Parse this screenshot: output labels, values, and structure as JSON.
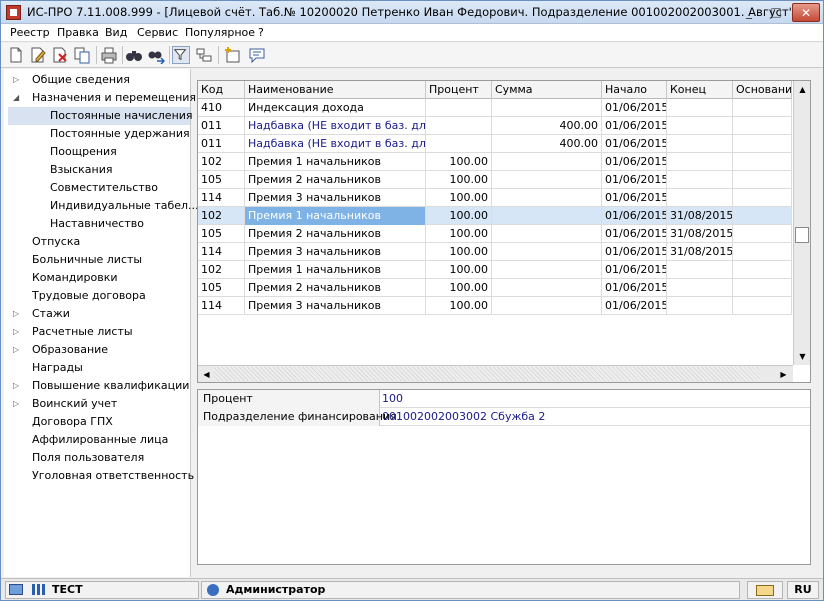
{
  "window": {
    "title": "ИС-ПРО 7.11.008.999 - [Лицевой счёт. Таб.№ 10200020 Петренко Иван Федорович. Подразделение 001002002003001. Август'15]",
    "min_label": "_",
    "max_label": "□",
    "close_label": "✕"
  },
  "menu": {
    "items": [
      "Реестр",
      "Правка",
      "Вид",
      "Сервис",
      "Популярное",
      "?"
    ]
  },
  "toolbar": {
    "icons": [
      "new-doc-icon",
      "edit-icon",
      "delete-icon",
      "copy-icon",
      "print-icon",
      "binoculars-icon",
      "find-next-icon",
      "filter-icon",
      "group-icon",
      "new-folder-icon",
      "comment-icon"
    ]
  },
  "tree": {
    "items": [
      {
        "label": "Общие сведения",
        "arrow": "▷"
      },
      {
        "label": "Назначения и перемещения",
        "arrow": "◢"
      },
      {
        "label": "Постоянные начисления",
        "arrow": ""
      },
      {
        "label": "Постоянные удержания",
        "arrow": ""
      },
      {
        "label": "Поощрения",
        "arrow": ""
      },
      {
        "label": "Взыскания",
        "arrow": ""
      },
      {
        "label": "Совместительство",
        "arrow": ""
      },
      {
        "label": "Индивидуальные табел...",
        "arrow": ""
      },
      {
        "label": "Наставничество",
        "arrow": ""
      },
      {
        "label": "Отпуска",
        "arrow": ""
      },
      {
        "label": "Больничные листы",
        "arrow": ""
      },
      {
        "label": "Командировки",
        "arrow": ""
      },
      {
        "label": "Трудовые договора",
        "arrow": ""
      },
      {
        "label": "Стажи",
        "arrow": "▷"
      },
      {
        "label": "Расчетные листы",
        "arrow": "▷"
      },
      {
        "label": "Образование",
        "arrow": "▷"
      },
      {
        "label": "Награды",
        "arrow": ""
      },
      {
        "label": "Повышение квалификации",
        "arrow": "▷"
      },
      {
        "label": "Воинский учет",
        "arrow": "▷"
      },
      {
        "label": "Договора ГПХ",
        "arrow": ""
      },
      {
        "label": "Аффилированные лица",
        "arrow": ""
      },
      {
        "label": "Поля пользователя",
        "arrow": ""
      },
      {
        "label": "Уголовная ответственность",
        "arrow": ""
      }
    ],
    "selected": "Постоянные начисления"
  },
  "grid": {
    "headers": [
      "Код",
      "Наименование",
      "Процент",
      "Сумма",
      "Начало",
      "Конец",
      "Основание"
    ],
    "rows": [
      [
        "410",
        "Индексация дохода",
        "",
        "",
        "01/06/2015",
        "",
        ""
      ],
      [
        "011",
        "Надбавка (НЕ входит в баз. для ...",
        "",
        "400.00",
        "01/06/2015",
        "",
        ""
      ],
      [
        "011",
        "Надбавка (НЕ входит в баз. для ...",
        "",
        "400.00",
        "01/06/2015",
        "",
        ""
      ],
      [
        "102",
        "Премия 1 начальников",
        "100.00",
        "",
        "01/06/2015",
        "",
        ""
      ],
      [
        "105",
        "Премия 2 начальников",
        "100.00",
        "",
        "01/06/2015",
        "",
        ""
      ],
      [
        "114",
        "Премия 3 начальников",
        "100.00",
        "",
        "01/06/2015",
        "",
        ""
      ],
      [
        "102",
        "Премия 1 начальников",
        "100.00",
        "",
        "01/06/2015",
        "31/08/2015",
        ""
      ],
      [
        "105",
        "Премия 2 начальников",
        "100.00",
        "",
        "01/06/2015",
        "31/08/2015",
        ""
      ],
      [
        "114",
        "Премия 3 начальников",
        "100.00",
        "",
        "01/06/2015",
        "31/08/2015",
        ""
      ],
      [
        "102",
        "Премия 1 начальников",
        "100.00",
        "",
        "01/06/2015",
        "",
        ""
      ],
      [
        "105",
        "Премия 2 начальников",
        "100.00",
        "",
        "01/06/2015",
        "",
        ""
      ],
      [
        "114",
        "Премия 3 начальников",
        "100.00",
        "",
        "01/06/2015",
        "",
        ""
      ]
    ],
    "selected_row": 6
  },
  "properties": [
    {
      "label": "Процент",
      "value": "100"
    },
    {
      "label": "Подразделение финансирования",
      "value": "001002002003002 Сбужба 2"
    }
  ],
  "status": {
    "db_label": "ТЕСТ",
    "user_label": "Администратор",
    "lang": "RU"
  }
}
